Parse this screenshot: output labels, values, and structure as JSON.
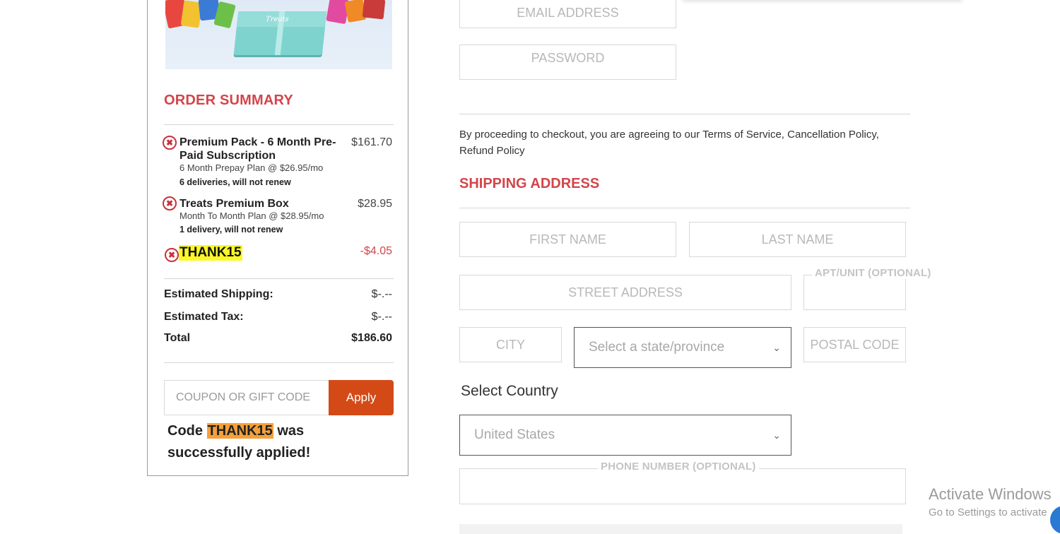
{
  "order_summary": {
    "title": "ORDER SUMMARY",
    "items": [
      {
        "name": "Premium Pack - 6 Month Pre-Paid Subscription",
        "plan": "6 Month Prepay Plan @ $26.95/mo",
        "note": "6 deliveries, will not renew",
        "price": "$161.70"
      },
      {
        "name": "Treats Premium Box",
        "plan": "Month To Month Plan @ $28.95/mo",
        "note": "1 delivery, will not renew",
        "price": "$28.95"
      }
    ],
    "coupon": {
      "code": "THANK15",
      "amount": "-$4.05"
    },
    "product_image_label": "Treats",
    "totals": {
      "shipping_label": "Estimated Shipping:",
      "shipping_value": "$-.--",
      "tax_label": "Estimated Tax:",
      "tax_value": "$-.--",
      "total_label": "Total",
      "total_value": "$186.60"
    },
    "coupon_input_placeholder": "COUPON OR GIFT CODE",
    "apply_label": "Apply",
    "success": {
      "prefix": "Code ",
      "code": "THANK15",
      "suffix": " was successfully applied!"
    }
  },
  "account": {
    "email_placeholder": "EMAIL ADDRESS",
    "password_placeholder": "PASSWORD"
  },
  "terms_text": "By proceeding to checkout, you are agreeing to our Terms of Service, Cancellation Policy, Refund Policy",
  "shipping": {
    "title": "SHIPPING ADDRESS",
    "first_name_placeholder": "FIRST NAME",
    "last_name_placeholder": "LAST NAME",
    "street_placeholder": "STREET ADDRESS",
    "apt_label": "APT/UNIT (OPTIONAL)",
    "city_placeholder": "CITY",
    "state_selected": "Select a state/province",
    "postal_placeholder": "POSTAL CODE",
    "country_label": "Select Country",
    "country_selected": "United States",
    "phone_label": "PHONE NUMBER (OPTIONAL)"
  },
  "watermark": {
    "title": "Activate Windows",
    "subtitle": "Go to Settings to activate"
  },
  "icons": {
    "remove": "remove-circle-icon",
    "chevron": "chevron-down-icon"
  },
  "colors": {
    "accent_red": "#d2454a",
    "apply_orange": "#d44a17",
    "coupon_highlight": "#fbf826",
    "success_highlight": "#f5a03a"
  }
}
